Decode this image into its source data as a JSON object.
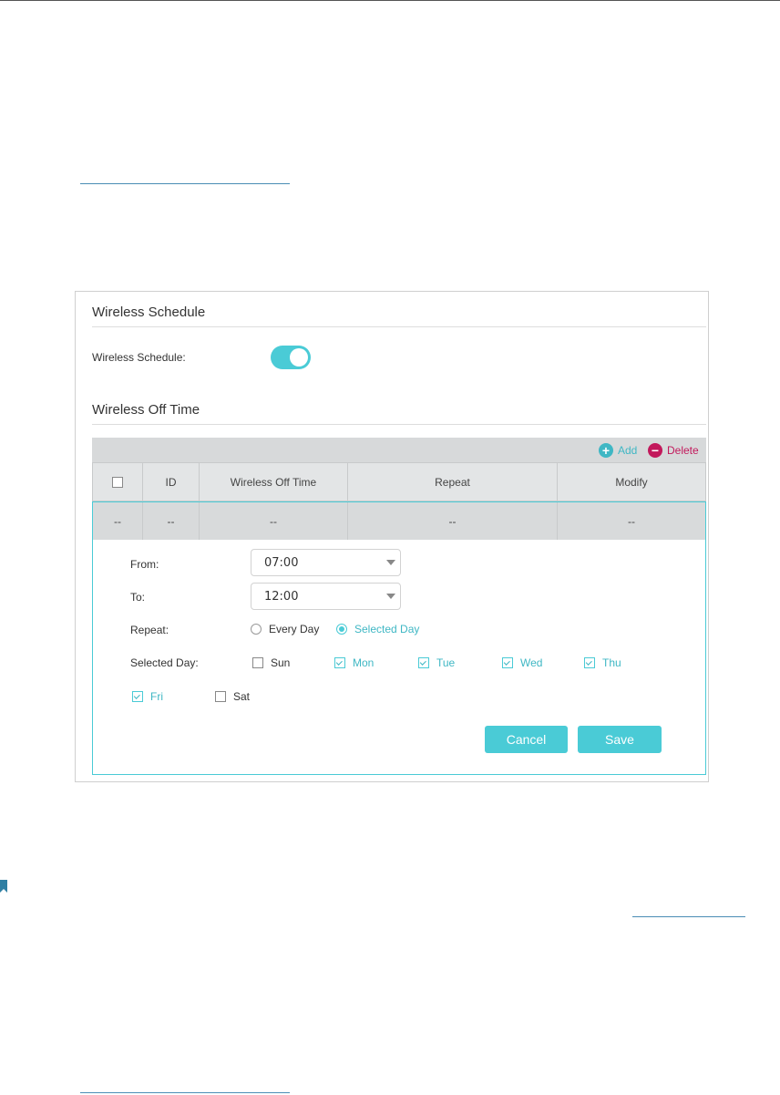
{
  "schedule": {
    "section_title": "Wireless Schedule",
    "toggle_label": "Wireless Schedule:",
    "toggle_on": true
  },
  "off_time": {
    "section_title": "Wireless Off Time",
    "add_label": "Add",
    "delete_label": "Delete",
    "columns": [
      "ID",
      "Wireless Off Time",
      "Repeat",
      "Modify"
    ],
    "row": [
      "--",
      "--",
      "--",
      "--",
      "--"
    ]
  },
  "form": {
    "from_label": "From:",
    "from_value": "07:00",
    "to_label": "To:",
    "to_value": "12:00",
    "repeat_label": "Repeat:",
    "repeat_options": [
      "Every Day",
      "Selected Day"
    ],
    "repeat_selected": "Selected Day",
    "selected_day_label": "Selected Day:",
    "days": [
      {
        "name": "Sun",
        "checked": false
      },
      {
        "name": "Mon",
        "checked": true
      },
      {
        "name": "Tue",
        "checked": true
      },
      {
        "name": "Wed",
        "checked": true
      },
      {
        "name": "Thu",
        "checked": true
      },
      {
        "name": "Fri",
        "checked": true
      },
      {
        "name": "Sat",
        "checked": false
      }
    ],
    "cancel_label": "Cancel",
    "save_label": "Save"
  },
  "colors": {
    "accent": "#4acbd6",
    "delete": "#c2185b"
  }
}
